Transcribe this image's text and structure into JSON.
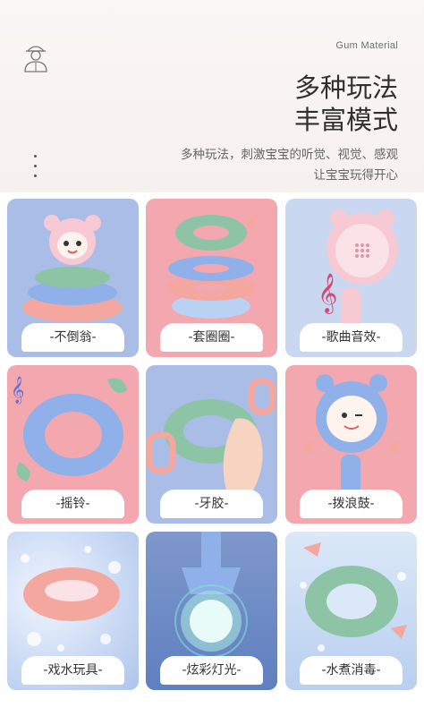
{
  "header": {
    "brand_label": "Gum Material",
    "title_line1": "多种玩法",
    "title_line2": "丰富模式",
    "subtitle_line1": "多种玩法，刺激宝宝的听觉、视觉、感观",
    "subtitle_line2": "让宝宝玩得开心",
    "badge_icon": "worker-icon"
  },
  "cards": [
    {
      "label": "-不倒翁-",
      "icon": "roly-poly-toy-icon"
    },
    {
      "label": "-套圈圈-",
      "icon": "stacking-rings-icon"
    },
    {
      "label": "-歌曲音效-",
      "icon": "music-rattle-icon"
    },
    {
      "label": "-摇铃-",
      "icon": "ring-rattle-icon"
    },
    {
      "label": "-牙胶-",
      "icon": "teether-icon"
    },
    {
      "label": "-拨浪鼓-",
      "icon": "pellet-drum-icon"
    },
    {
      "label": "-戏水玩具-",
      "icon": "bath-toy-icon"
    },
    {
      "label": "-炫彩灯光-",
      "icon": "light-up-toy-icon"
    },
    {
      "label": "-水煮消毒-",
      "icon": "boil-sterilize-icon"
    }
  ],
  "colors": {
    "pink": "#f2a8ae",
    "blue": "#a9bde6",
    "green_ring": "#8ec4a6",
    "blue_ring": "#8fb0e8",
    "salmon_ring": "#f4a79e"
  }
}
